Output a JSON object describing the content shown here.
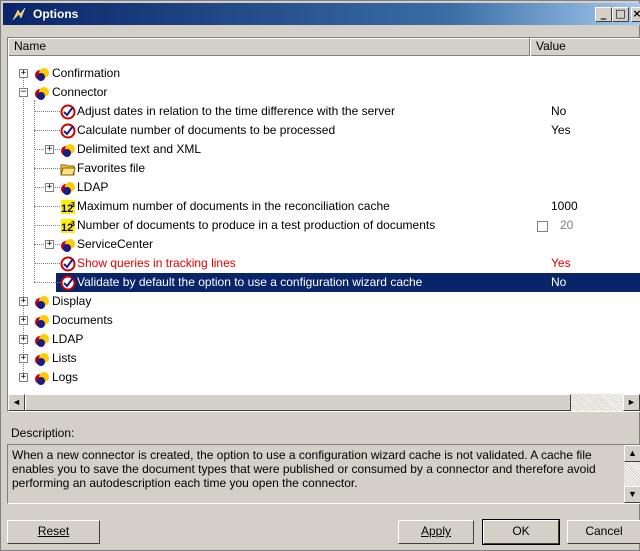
{
  "window": {
    "title": "Options",
    "minimize": "_",
    "maximize": "□",
    "close": "×"
  },
  "columns": {
    "name": "Name",
    "value": "Value"
  },
  "tree": [
    {
      "label": "Confirmation",
      "depth": 0,
      "icon": "category-icon",
      "expander": "+",
      "value": ""
    },
    {
      "label": "Connector",
      "depth": 0,
      "icon": "category-icon",
      "expander": "−",
      "value": ""
    },
    {
      "label": "Adjust dates in relation to the time difference with the server",
      "depth": 1,
      "icon": "boolean-option-icon",
      "expander": "",
      "value": "No"
    },
    {
      "label": "Calculate number of documents to be processed",
      "depth": 1,
      "icon": "boolean-option-icon",
      "expander": "",
      "value": "Yes"
    },
    {
      "label": "Delimited text and XML",
      "depth": 1,
      "icon": "category-icon",
      "expander": "+",
      "value": ""
    },
    {
      "label": "Favorites file",
      "depth": 1,
      "icon": "folder-icon",
      "expander": "",
      "value": ""
    },
    {
      "label": "LDAP",
      "depth": 1,
      "icon": "category-icon",
      "expander": "+",
      "value": ""
    },
    {
      "label": "Maximum number of documents in the reconciliation cache",
      "depth": 1,
      "icon": "numeric-option-icon",
      "expander": "",
      "value": "1000"
    },
    {
      "label": "Number of documents to produce in a test production of documents",
      "depth": 1,
      "icon": "numeric-option-icon",
      "expander": "",
      "value": "20",
      "checkbox": true,
      "disabled": true
    },
    {
      "label": "ServiceCenter",
      "depth": 1,
      "icon": "category-icon",
      "expander": "+",
      "value": ""
    },
    {
      "label": "Show queries in tracking lines",
      "depth": 1,
      "icon": "boolean-option-icon",
      "expander": "",
      "value": "Yes",
      "modified": true
    },
    {
      "label": "Validate by default the option to use a configuration wizard cache",
      "depth": 1,
      "icon": "boolean-option-icon",
      "expander": "",
      "value": "No",
      "selected": true
    },
    {
      "label": "Display",
      "depth": 0,
      "icon": "category-icon",
      "expander": "+",
      "value": ""
    },
    {
      "label": "Documents",
      "depth": 0,
      "icon": "category-icon",
      "expander": "+",
      "value": ""
    },
    {
      "label": "LDAP",
      "depth": 0,
      "icon": "category-icon",
      "expander": "+",
      "value": ""
    },
    {
      "label": "Lists",
      "depth": 0,
      "icon": "category-icon",
      "expander": "+",
      "value": ""
    },
    {
      "label": "Logs",
      "depth": 0,
      "icon": "category-icon",
      "expander": "+",
      "value": ""
    }
  ],
  "scroll": {
    "left": "◄",
    "right": "►",
    "up": "▲",
    "down": "▼"
  },
  "description": {
    "label": "Description:",
    "text": "When a new connector is created, the option to use a configuration wizard cache is not validated. A cache file enables you to save the document types that were published or consumed by a connector and therefore avoid performing an autodescription each time you open the connector."
  },
  "buttons": {
    "reset": "Reset",
    "apply": "Apply",
    "ok": "OK",
    "cancel": "Cancel"
  },
  "colors": {
    "titlebar": "#0a246a",
    "selection": "#0a246a",
    "modified_text": "#e00000"
  }
}
